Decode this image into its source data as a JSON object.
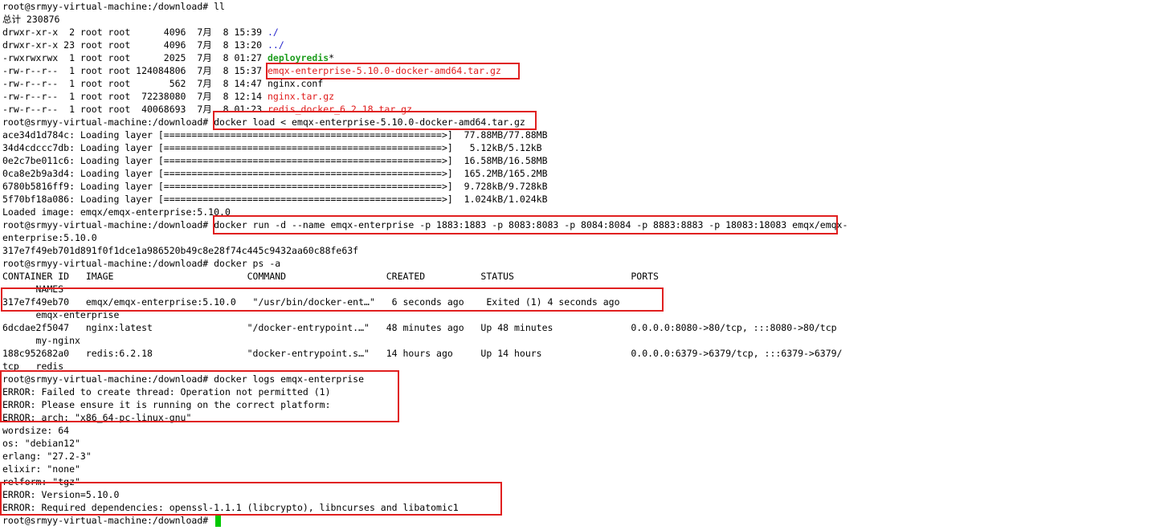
{
  "colors": {
    "background": "#ffffff",
    "text": "#000000",
    "directory": "#2222cc",
    "executable": "#1f9e1f",
    "archive": "#e01b1b",
    "highlight_box": "#e02020",
    "cursor": "#00c800"
  },
  "terminal": {
    "lines": [
      [
        {
          "t": "root@srmyy-virtual-machine:/download# ll"
        }
      ],
      [
        {
          "t": "总计 230876"
        }
      ],
      [
        {
          "t": "drwxr-xr-x  2 root root      4096  7月  8 15:39 "
        },
        {
          "t": "./",
          "c": "dir"
        }
      ],
      [
        {
          "t": "drwxr-xr-x 23 root root      4096  7月  8 13:20 "
        },
        {
          "t": "../",
          "c": "dir"
        }
      ],
      [
        {
          "t": "-rwxrwxrwx  1 root root      2025  7月  8 01:27 "
        },
        {
          "t": "deployredis",
          "c": "exec"
        },
        {
          "t": "*"
        }
      ],
      [
        {
          "t": "-rw-r--r--  1 root root 124084806  7月  8 15:37 "
        },
        {
          "t": "emqx-enterprise-5.10.0-docker-amd64.tar.gz",
          "c": "archive"
        }
      ],
      [
        {
          "t": "-rw-r--r--  1 root root       562  7月  8 14:47 nginx.conf"
        }
      ],
      [
        {
          "t": "-rw-r--r--  1 root root  72238080  7月  8 12:14 "
        },
        {
          "t": "nginx.tar.gz",
          "c": "archive"
        }
      ],
      [
        {
          "t": "-rw-r--r--  1 root root  40068693  7月  8 01:23 "
        },
        {
          "t": "redis_docker_6.2.18.tar.gz",
          "c": "archive"
        }
      ],
      [
        {
          "t": "root@srmyy-virtual-machine:/download# docker load < emqx-enterprise-5.10.0-docker-amd64.tar.gz"
        }
      ],
      [
        {
          "t": "ace34d1d784c: Loading layer [==================================================>]  77.88MB/77.88MB"
        }
      ],
      [
        {
          "t": "34d4cdccc7db: Loading layer [==================================================>]   5.12kB/5.12kB"
        }
      ],
      [
        {
          "t": "0e2c7be011c6: Loading layer [==================================================>]  16.58MB/16.58MB"
        }
      ],
      [
        {
          "t": "0ca8e2b9a3d4: Loading layer [==================================================>]  165.2MB/165.2MB"
        }
      ],
      [
        {
          "t": "6780b5816ff9: Loading layer [==================================================>]  9.728kB/9.728kB"
        }
      ],
      [
        {
          "t": "5f70bf18a086: Loading layer [==================================================>]  1.024kB/1.024kB"
        }
      ],
      [
        {
          "t": "Loaded image: emqx/emqx-enterprise:5.10.0"
        }
      ],
      [
        {
          "t": "root@srmyy-virtual-machine:/download# docker run -d --name emqx-enterprise -p 1883:1883 -p 8083:8083 -p 8084:8084 -p 8883:8883 -p 18083:18083 emqx/emqx-"
        }
      ],
      [
        {
          "t": "enterprise:5.10.0"
        }
      ],
      [
        {
          "t": "317e7f49eb701d891f0f1dce1a986520b49c8e28f74c445c9432aa60c88fe63f"
        }
      ],
      [
        {
          "t": "root@srmyy-virtual-machine:/download# docker ps -a"
        }
      ],
      [
        {
          "t": "CONTAINER ID   IMAGE                        COMMAND                  CREATED          STATUS                     PORTS"
        }
      ],
      [
        {
          "t": "      NAMES"
        }
      ],
      [
        {
          "t": "317e7f49eb70   emqx/emqx-enterprise:5.10.0   \"/usr/bin/docker-ent…\"   6 seconds ago    Exited (1) 4 seconds ago"
        }
      ],
      [
        {
          "t": "      emqx-enterprise"
        }
      ],
      [
        {
          "t": "6dcdae2f5047   nginx:latest                 \"/docker-entrypoint.…\"   48 minutes ago   Up 48 minutes              0.0.0.0:8080->80/tcp, :::8080->80/tcp"
        }
      ],
      [
        {
          "t": "      my-nginx"
        }
      ],
      [
        {
          "t": "188c952682a0   redis:6.2.18                 \"docker-entrypoint.s…\"   14 hours ago     Up 14 hours                0.0.0.0:6379->6379/tcp, :::6379->6379/"
        }
      ],
      [
        {
          "t": "tcp   redis"
        }
      ],
      [
        {
          "t": "root@srmyy-virtual-machine:/download# docker logs emqx-enterprise"
        }
      ],
      [
        {
          "t": "ERROR: Failed to create thread: Operation not permitted (1)"
        }
      ],
      [
        {
          "t": "ERROR: Please ensure it is running on the correct platform:"
        }
      ],
      [
        {
          "t": "ERROR: arch: \"x86_64-pc-linux-gnu\""
        }
      ],
      [
        {
          "t": "wordsize: 64"
        }
      ],
      [
        {
          "t": "os: \"debian12\""
        }
      ],
      [
        {
          "t": "erlang: \"27.2-3\""
        }
      ],
      [
        {
          "t": "elixir: \"none\""
        }
      ],
      [
        {
          "t": "relform: \"tgz\""
        }
      ],
      [
        {
          "t": "ERROR: Version=5.10.0"
        }
      ],
      [
        {
          "t": "ERROR: Required dependencies: openssl-1.1.1 (libcrypto), libncurses and libatomic1"
        }
      ],
      [
        {
          "t": "root@srmyy-virtual-machine:/download# "
        }
      ]
    ]
  }
}
